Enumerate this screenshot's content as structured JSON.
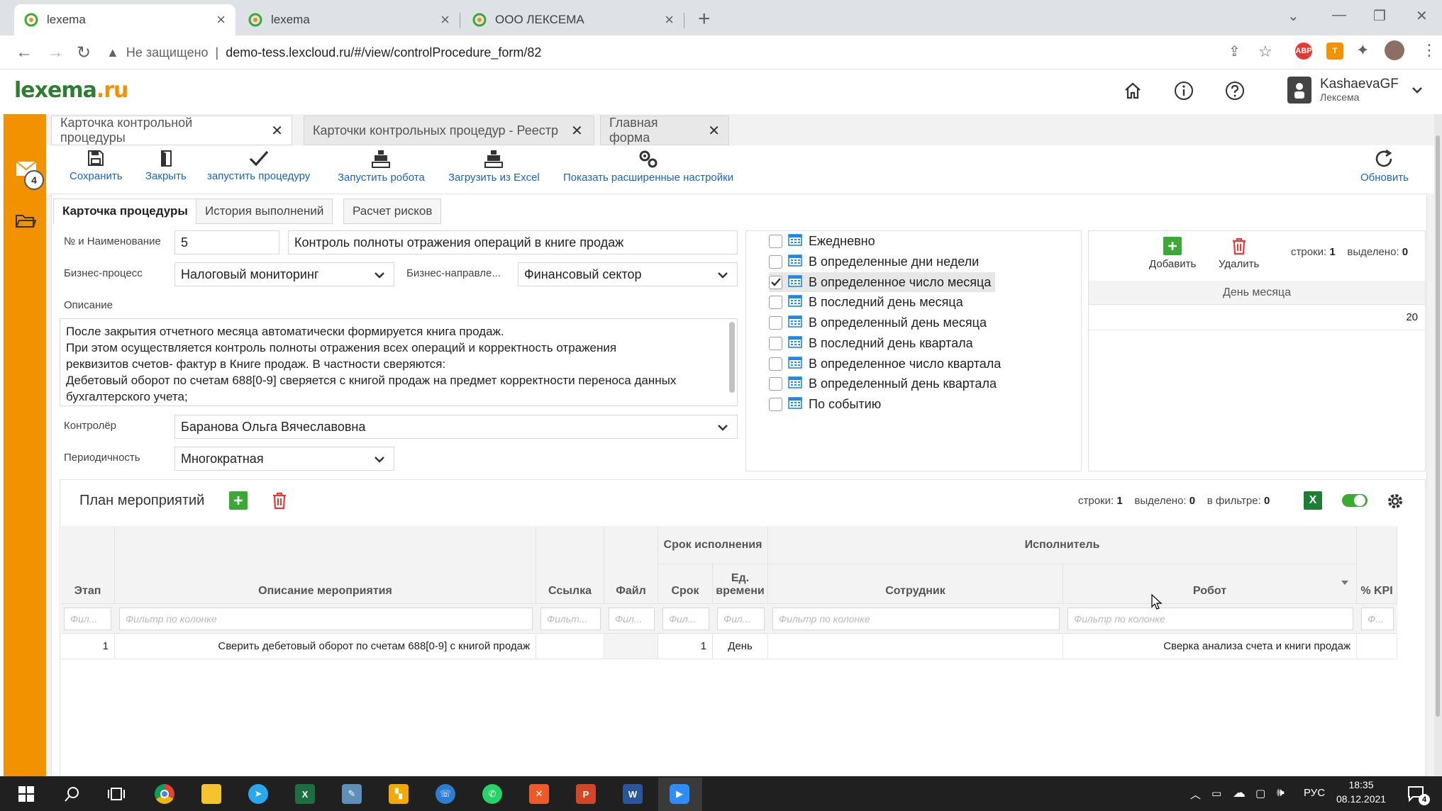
{
  "browser": {
    "tabs": [
      {
        "title": "lexema"
      },
      {
        "title": "lexema"
      },
      {
        "title": "ООО ЛЕКСЕМА"
      }
    ],
    "security_label": "Не защищено",
    "url": "demo-tess.lexcloud.ru/#/view/controlProcedure_form/82",
    "ext_abp": "ABP",
    "ext_t": "T"
  },
  "app": {
    "logo_text": "lexema",
    "logo_suffix": ".ru",
    "user_name": "KashaevaGF",
    "user_org": "Лексема",
    "mail_badge": "4"
  },
  "form_tabs": [
    {
      "label": "Карточка контрольной процедуры"
    },
    {
      "label": "Карточки контрольных процедур - Реестр"
    },
    {
      "label": "Главная форма"
    }
  ],
  "toolbar": {
    "save": "Сохранить",
    "close": "Закрыть",
    "run_procedure": "запустить процедуру",
    "run_robot": "Запустить робота",
    "load_excel": "Загрузить из Excel",
    "show_settings": "Показать расширенные настройки",
    "refresh": "Обновить"
  },
  "sub_tabs": [
    {
      "label": "Карточка процедуры"
    },
    {
      "label": "История выполнений"
    },
    {
      "label": "Расчет рисков"
    }
  ],
  "fields": {
    "name_label": "№ и Наименование",
    "number": "5",
    "name": "Контроль полноты отражения операций в книге продаж",
    "business_process_label": "Бизнес-процесс",
    "business_process": "Налоговый мониторинг",
    "business_direction_label": "Бизнес-направле...",
    "business_direction": "Финансовый сектор",
    "description_label": "Описание",
    "description_lines": [
      "После закрытия отчетного месяца автоматически формируется книга продаж.",
      "При этом осуществляется контроль полноты отражения всех операций и корректность отражения",
      "реквизитов счетов- фактур в Книге продаж. В частности сверяются:",
      "Дебетовый оборот по счетам 688[0-9] сверяется с книгой продаж на предмет корректности переноса данных",
      "бухгалтерского учета;"
    ],
    "controller_label": "Контролёр",
    "controller": "Баранова Ольга Вячеславовна",
    "periodicity_label": "Периодичность",
    "periodicity": "Многократная"
  },
  "periods": [
    {
      "label": "Ежедневно",
      "checked": false
    },
    {
      "label": "В определенные дни недели",
      "checked": false
    },
    {
      "label": "В определенное число месяца",
      "checked": true
    },
    {
      "label": "В последний день месяца",
      "checked": false
    },
    {
      "label": "В определенный день месяца",
      "checked": false
    },
    {
      "label": "В последний день квартала",
      "checked": false
    },
    {
      "label": "В определенное число квартала",
      "checked": false
    },
    {
      "label": "В определенный день квартала",
      "checked": false
    },
    {
      "label": "По событию",
      "checked": false
    }
  ],
  "day_panel": {
    "add": "Добавить",
    "delete": "Удалить",
    "rows_label": "строки:",
    "rows_value": "1",
    "selected_label": "выделено:",
    "selected_value": "0",
    "column": "День месяца",
    "value": "20"
  },
  "plan": {
    "title": "План мероприятий",
    "rows_label": "строки:",
    "rows_value": "1",
    "selected_label": "выделено:",
    "selected_value": "0",
    "filter_label": "в фильтре:",
    "filter_value": "0",
    "group_deadline": "Срок исполнения",
    "group_executor": "Исполнитель",
    "columns": {
      "stage": "Этап",
      "description": "Описание мероприятия",
      "link": "Ссылка",
      "file": "Файл",
      "term": "Срок",
      "unit": "Ед. времени",
      "employee": "Сотрудник",
      "robot": "Робот",
      "kpi": "% KPI"
    },
    "filter_placeholders": {
      "short": "Фил...",
      "medium": "Фильт...",
      "long": "Фильтр по колонке",
      "tiny": "Ф..."
    },
    "rows": [
      {
        "stage": "1",
        "description": "Сверить дебетовый оборот по счетам 688[0-9] с книгой продаж",
        "term": "1",
        "unit": "День",
        "robot": "Сверка анализа счета и книги продаж"
      }
    ]
  },
  "taskbar": {
    "lang": "РУС",
    "time": "18:35",
    "date": "08.12.2021",
    "notif_count": "4"
  }
}
